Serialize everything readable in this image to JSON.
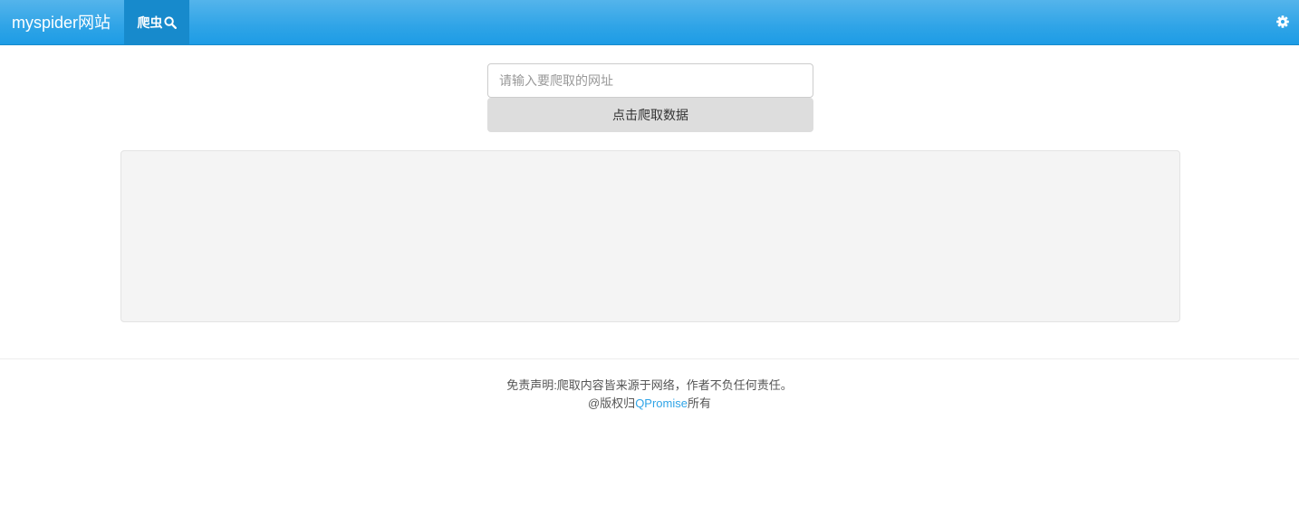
{
  "navbar": {
    "brand": "myspider网站",
    "active_item": {
      "label": "爬虫",
      "icon": "search-icon"
    },
    "settings_icon": "gear-icon",
    "colors": {
      "bar": "#2fa4e7",
      "active": "#178acc"
    }
  },
  "form": {
    "url_placeholder": "请输入要爬取的网址",
    "url_value": "",
    "submit_label": "点击爬取数据"
  },
  "result": {
    "content": ""
  },
  "footer": {
    "disclaimer": "免责声明:爬取内容皆来源于网络，作者不负任何责任。",
    "copyright_prefix": "@版权归",
    "owner_link": "QPromise",
    "copyright_suffix": "所有",
    "link_color": "#2fa4e7"
  }
}
